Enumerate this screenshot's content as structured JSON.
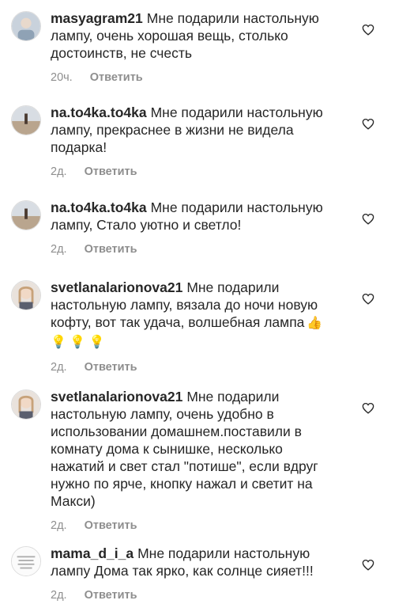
{
  "comments": [
    {
      "username": "masyagram21",
      "text": "Мне подарили настольную лампу, очень хорошая вещь, столько достоинств, не счесть",
      "time": "20ч.",
      "reply_label": "Ответить",
      "like_icon": "heart-outline-icon"
    },
    {
      "username": "na.to4ka.to4ka",
      "text": "Мне подарили настольную лампу, прекраснее в жизни не видела подарка!",
      "time": "2д.",
      "reply_label": "Ответить",
      "like_icon": "heart-outline-icon"
    },
    {
      "username": "na.to4ka.to4ka",
      "text": "Мне подарили настольную лампу, Стало уютно и светло!",
      "time": "2д.",
      "reply_label": "Ответить",
      "like_icon": "heart-outline-icon"
    },
    {
      "username": "svetlanalarionova21",
      "text": "Мне подарили настольную лампу, вязала до ночи новую кофту, вот так удача, волшебная лампа",
      "emoji": "👍 💡 💡 💡",
      "time": "2д.",
      "reply_label": "Ответить",
      "like_icon": "heart-outline-icon"
    },
    {
      "username": "svetlanalarionova21",
      "text": "Мне подарили настольную лампу, очень удобно в использовании домашнем.поставили в комнату дома к сынишке, несколько нажатий и свет стал \"потише\", если вдруг нужно по ярче, кнопку нажал и светит на Макси)",
      "time": "2д.",
      "reply_label": "Ответить",
      "like_icon": "heart-outline-icon"
    },
    {
      "username": "mama_d_i_a",
      "text": "Мне подарили настольную лампу Дома так ярко, как солнце сияет!!!",
      "time": "2д.",
      "reply_label": "Ответить",
      "like_icon": "heart-outline-icon"
    }
  ]
}
